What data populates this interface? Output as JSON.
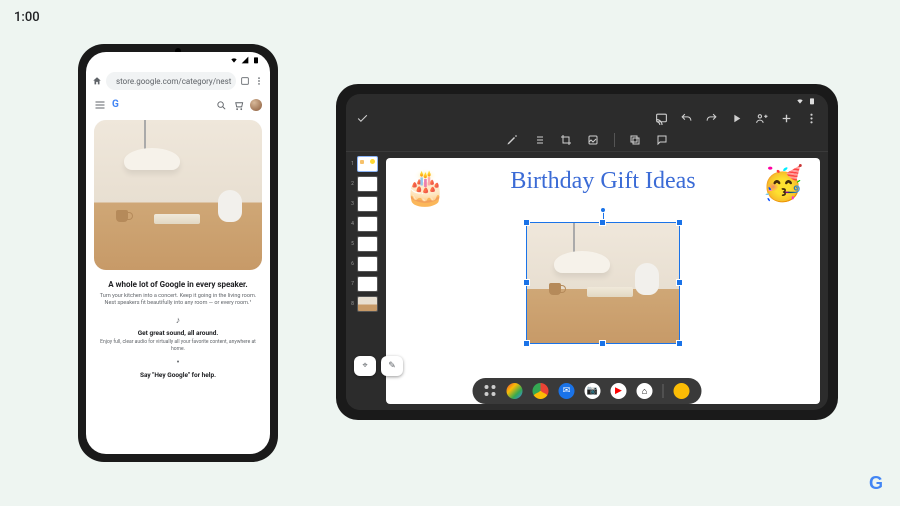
{
  "presenter": {
    "time": "1:00"
  },
  "phone": {
    "url": "store.google.com/category/nest",
    "page": {
      "hero_title": "A whole lot of Google in every speaker.",
      "hero_desc": "Turn your kitchen into a concert. Keep it going in the living room. Nest speakers fit beautifully into any room — or every room.¹",
      "feat1_title": "Get great sound, all around.",
      "feat1_desc": "Enjoy full, clear audio for virtually all your favorite content, anywhere at home.",
      "feat2_title": "Say \"Hey Google\" for help."
    }
  },
  "tablet": {
    "canvas": {
      "title": "Birthday Gift Ideas"
    },
    "thumbs": [
      "1",
      "2",
      "3",
      "4",
      "5",
      "6",
      "7",
      "8"
    ]
  }
}
